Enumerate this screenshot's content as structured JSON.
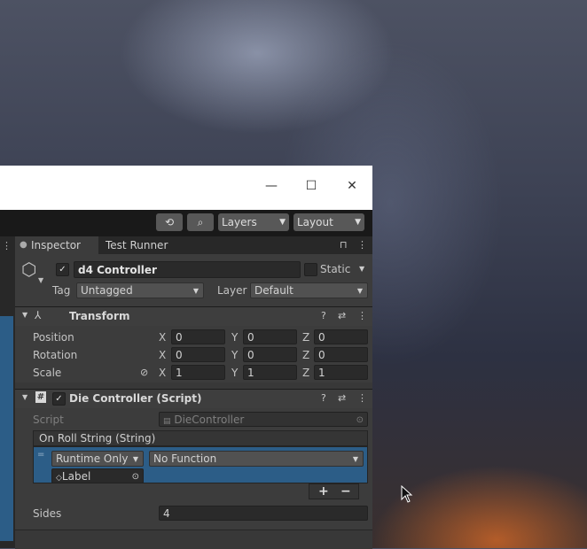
{
  "window": {
    "minimize_icon": "—",
    "maximize_icon": "☐",
    "close_icon": "✕"
  },
  "toolbar": {
    "history_icon": "⟲",
    "search_icon": "⌕",
    "layers_label": "Layers",
    "layout_label": "Layout"
  },
  "tabs": {
    "inspector": "Inspector",
    "test_runner": "Test Runner"
  },
  "object": {
    "name": "d4 Controller",
    "static_label": "Static",
    "tag_label": "Tag",
    "tag_value": "Untagged",
    "layer_label": "Layer",
    "layer_value": "Default"
  },
  "transform": {
    "title": "Transform",
    "rows": [
      {
        "label": "Position",
        "x": "0",
        "y": "0",
        "z": "0"
      },
      {
        "label": "Rotation",
        "x": "0",
        "y": "0",
        "z": "0"
      },
      {
        "label": "Scale",
        "x": "1",
        "y": "1",
        "z": "1"
      }
    ],
    "axis_x": "X",
    "axis_y": "Y",
    "axis_z": "Z"
  },
  "die_controller": {
    "title": "Die Controller (Script)",
    "script_label": "Script",
    "script_value": "DieController",
    "event_header": "On Roll String (String)",
    "runtime_value": "Runtime Only",
    "function_value": "No Function",
    "target_value": "Label",
    "add_label": "+",
    "remove_label": "−",
    "sides_label": "Sides",
    "sides_value": "4"
  },
  "colors": {
    "inspector_bg": "#383838",
    "highlight_blue": "#2c5d87",
    "title_bar": "#ffffff"
  }
}
